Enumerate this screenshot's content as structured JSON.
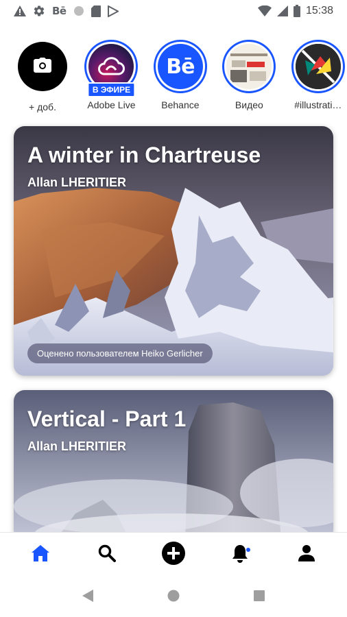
{
  "status_bar": {
    "time": "15:38",
    "be_label": "Bē",
    "icons": [
      "warning-icon",
      "settings-icon",
      "behance-icon",
      "circle-icon",
      "sd-card-icon",
      "play-store-icon",
      "wifi-icon",
      "signal-icon",
      "battery-icon"
    ]
  },
  "stories": [
    {
      "label": "+ доб.",
      "icon": "camera-icon",
      "type": "add"
    },
    {
      "label": "Adobe Live",
      "badge": "В ЭФИРЕ",
      "icon": "creative-cloud-icon"
    },
    {
      "label": "Behance",
      "icon": "behance-logo-icon",
      "logo_text": "Bē"
    },
    {
      "label": "Видео",
      "icon": "video-thumbnail"
    },
    {
      "label": "#illustrati…",
      "icon": "illustration-thumbnail"
    },
    {
      "label": "#",
      "icon": "more-thumbnail"
    }
  ],
  "cards": [
    {
      "title": "A winter in Chartreuse",
      "author": "Allan LHERITIER",
      "rated_by": "Оценено пользователем Heiko Gerlicher"
    },
    {
      "title": "Vertical - Part 1",
      "author": "Allan LHERITIER"
    }
  ],
  "bottom_nav": {
    "items": [
      "home-icon",
      "search-icon",
      "add-icon",
      "notifications-icon",
      "profile-icon"
    ],
    "active_color": "#1a56ff"
  },
  "colors": {
    "accent": "#1a56ff"
  }
}
